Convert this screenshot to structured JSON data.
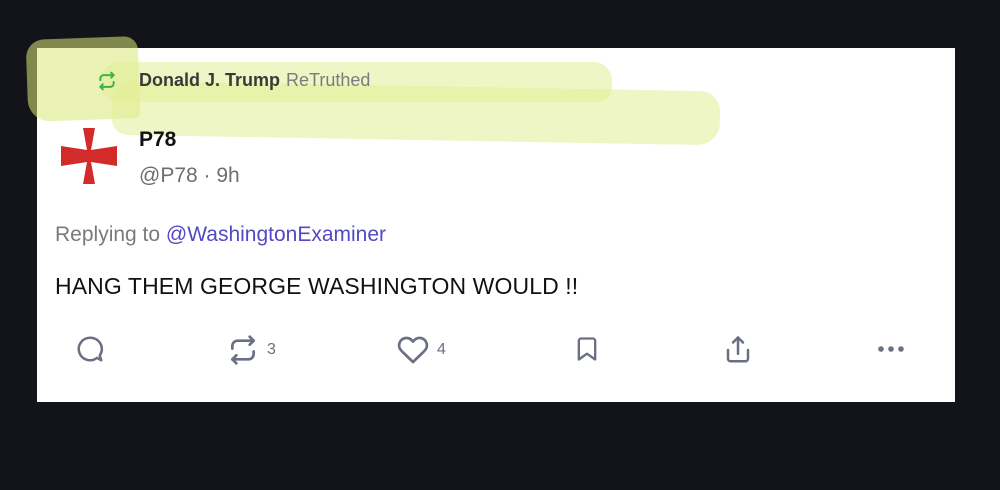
{
  "post": {
    "retruth": {
      "user": "Donald J. Trump",
      "action": "ReTruthed",
      "icon": "retruth-icon",
      "icon_color": "#3cb24a"
    },
    "author": {
      "display_name": "P78",
      "handle": "@P78",
      "separator": "·",
      "time_ago": "9h",
      "avatar_icon": "red-cross-pattee",
      "avatar_color": "#d32a2a"
    },
    "reply": {
      "prefix": "Replying to",
      "handle": "@WashingtonExaminer",
      "handle_color": "#5448c4"
    },
    "body": "HANG THEM GEORGE WASHINGTON WOULD !!",
    "actions": {
      "reply": {
        "icon": "reply-icon"
      },
      "retruth": {
        "icon": "retruth-icon",
        "count": "3"
      },
      "like": {
        "icon": "heart-icon",
        "count": "4"
      },
      "bookmark": {
        "icon": "bookmark-icon"
      },
      "share": {
        "icon": "share-icon"
      },
      "more": {
        "icon": "more-icon"
      }
    }
  },
  "colors": {
    "highlight": "#e3eda0",
    "background": "#13141a",
    "card": "#ffffff"
  }
}
